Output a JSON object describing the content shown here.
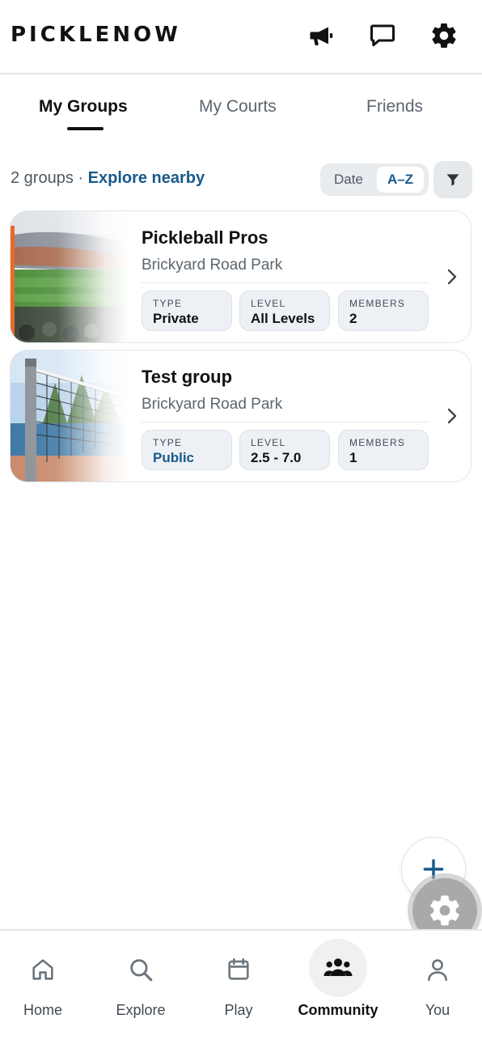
{
  "header": {
    "logo": "PICKLENOW",
    "icons": [
      "megaphone-icon",
      "chat-icon",
      "gear-icon"
    ]
  },
  "tabs": [
    {
      "label": "My Groups",
      "active": true
    },
    {
      "label": "My Courts",
      "active": false
    },
    {
      "label": "Friends",
      "active": false
    }
  ],
  "summary": {
    "count_text": "2 groups",
    "separator": "·",
    "explore_link": "Explore nearby"
  },
  "sort": {
    "options": [
      "Date",
      "A–Z"
    ],
    "selected": "A–Z"
  },
  "groups": [
    {
      "name": "Pickleball Pros",
      "location": "Brickyard Road Park",
      "image": "stadium-photo",
      "accent_color": "#e86a2a",
      "stats": [
        {
          "label": "TYPE",
          "value": "Private"
        },
        {
          "label": "LEVEL",
          "value": "All Levels"
        },
        {
          "label": "MEMBERS",
          "value": "2"
        }
      ]
    },
    {
      "name": "Test group",
      "location": "Brickyard Road Park",
      "image": "tennis-net-photo",
      "stats": [
        {
          "label": "TYPE",
          "value": "Public"
        },
        {
          "label": "LEVEL",
          "value": "2.5 - 7.0"
        },
        {
          "label": "MEMBERS",
          "value": "1"
        }
      ]
    }
  ],
  "fab": {
    "icon": "plus-icon"
  },
  "bottom_nav": [
    {
      "label": "Home",
      "icon": "home-icon",
      "active": false
    },
    {
      "label": "Explore",
      "icon": "search-icon",
      "active": false
    },
    {
      "label": "Play",
      "icon": "calendar-icon",
      "active": false
    },
    {
      "label": "Community",
      "icon": "people-icon",
      "active": true
    },
    {
      "label": "You",
      "icon": "person-icon",
      "active": false
    }
  ],
  "colors": {
    "accent_blue": "#175a8c",
    "text_dark": "#111111",
    "text_muted": "#5b6670",
    "chip_bg": "#edf1f5"
  }
}
